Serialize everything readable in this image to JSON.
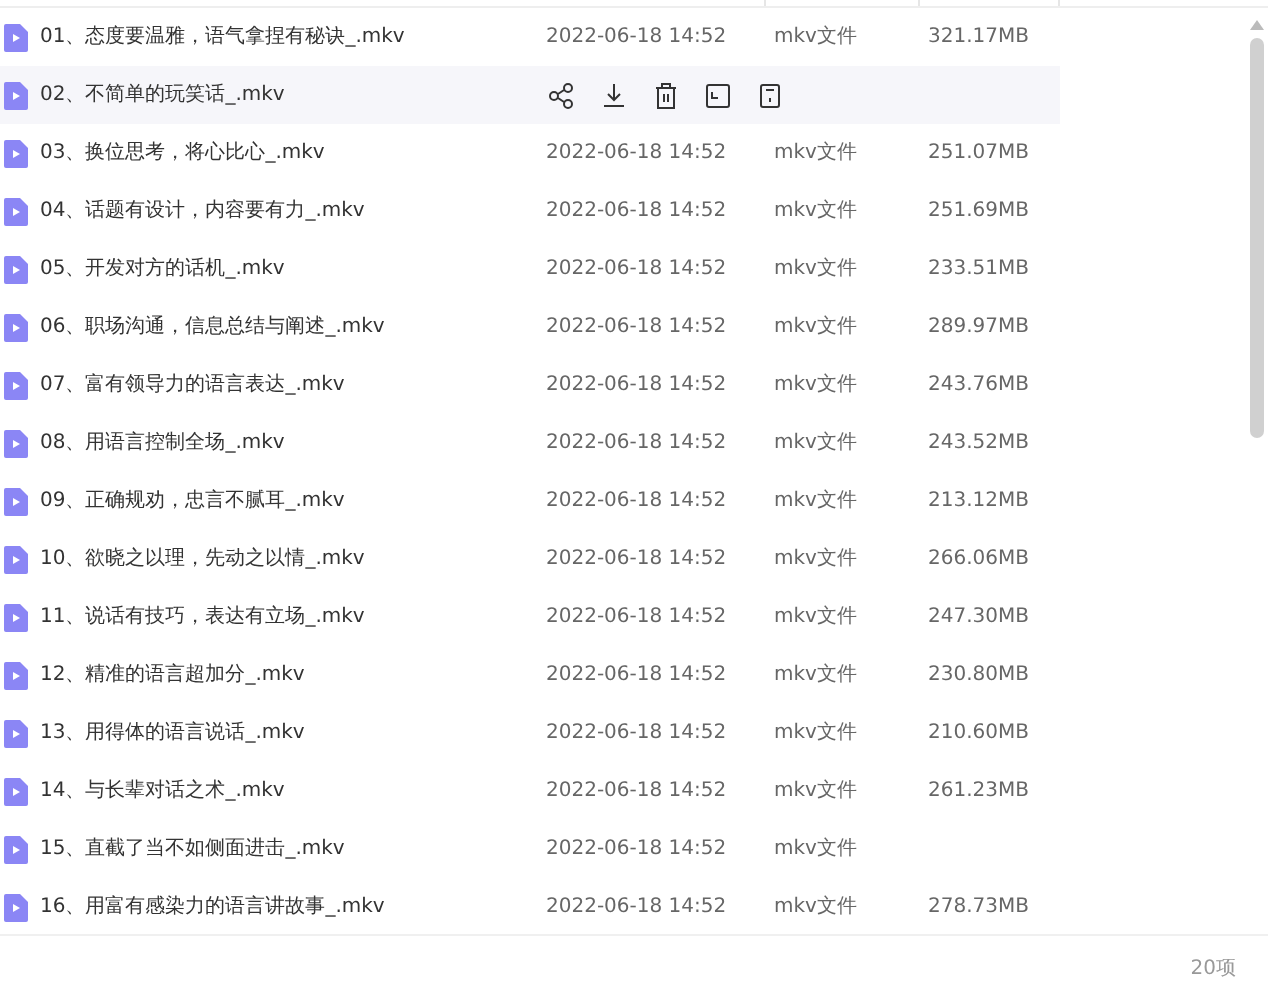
{
  "files": [
    {
      "name": "01、态度要温雅，语气拿捏有秘诀_.mkv",
      "hovered": false,
      "date": "2022-06-18 14:52",
      "type": "mkv文件",
      "size": "321.17MB"
    },
    {
      "name": "02、不简单的玩笑话_.mkv",
      "hovered": true
    },
    {
      "name": "03、换位思考，将心比心_.mkv",
      "hovered": false,
      "date": "2022-06-18 14:52",
      "type": "mkv文件",
      "size": "251.07MB"
    },
    {
      "name": "04、话题有设计，内容要有力_.mkv",
      "hovered": false,
      "date": "2022-06-18 14:52",
      "type": "mkv文件",
      "size": "251.69MB"
    },
    {
      "name": "05、开发对方的话机_.mkv",
      "hovered": false,
      "date": "2022-06-18 14:52",
      "type": "mkv文件",
      "size": "233.51MB"
    },
    {
      "name": "06、职场沟通，信息总结与阐述_.mkv",
      "hovered": false,
      "date": "2022-06-18 14:52",
      "type": "mkv文件",
      "size": "289.97MB"
    },
    {
      "name": "07、富有领导力的语言表达_.mkv",
      "hovered": false,
      "date": "2022-06-18 14:52",
      "type": "mkv文件",
      "size": "243.76MB"
    },
    {
      "name": "08、用语言控制全场_.mkv",
      "hovered": false,
      "date": "2022-06-18 14:52",
      "type": "mkv文件",
      "size": "243.52MB"
    },
    {
      "name": "09、正确规劝，忠言不腻耳_.mkv",
      "hovered": false,
      "date": "2022-06-18 14:52",
      "type": "mkv文件",
      "size": "213.12MB"
    },
    {
      "name": "10、欲晓之以理，先动之以情_.mkv",
      "hovered": false,
      "date": "2022-06-18 14:52",
      "type": "mkv文件",
      "size": "266.06MB"
    },
    {
      "name": "11、说话有技巧，表达有立场_.mkv",
      "hovered": false,
      "date": "2022-06-18 14:52",
      "type": "mkv文件",
      "size": "247.30MB"
    },
    {
      "name": "12、精准的语言超加分_.mkv",
      "hovered": false,
      "date": "2022-06-18 14:52",
      "type": "mkv文件",
      "size": "230.80MB"
    },
    {
      "name": "13、用得体的语言说话_.mkv",
      "hovered": false,
      "date": "2022-06-18 14:52",
      "type": "mkv文件",
      "size": "210.60MB"
    },
    {
      "name": "14、与长辈对话之术_.mkv",
      "hovered": false,
      "date": "2022-06-18 14:52",
      "type": "mkv文件",
      "size": "261.23MB"
    },
    {
      "name": "15、直截了当不如侧面进击_.mkv",
      "hovered": false,
      "date": "2022-06-18 14:52",
      "type": "mkv文件"
    },
    {
      "name": "16、用富有感染力的语言讲故事_.mkv",
      "hovered": false,
      "date": "2022-06-18 14:52",
      "type": "mkv文件",
      "size": "278.73MB"
    }
  ],
  "footer": {
    "count": "20项"
  }
}
